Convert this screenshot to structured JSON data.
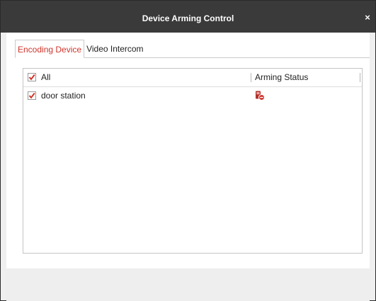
{
  "window": {
    "title": "Device Arming Control",
    "close_label": "×"
  },
  "tabs": [
    {
      "label": "Encoding Device",
      "active": true
    },
    {
      "label": "Video Intercom",
      "active": false
    }
  ],
  "list": {
    "header": {
      "select_all_label": "All",
      "select_all_checked": true,
      "status_column": "Arming Status"
    },
    "rows": [
      {
        "name": "door station",
        "checked": true,
        "status_icon": "disarmed-status-icon"
      }
    ]
  },
  "colors": {
    "titlebar": "#3a3a3a",
    "accent": "#d0352b",
    "status_icon": "#c9302c"
  }
}
